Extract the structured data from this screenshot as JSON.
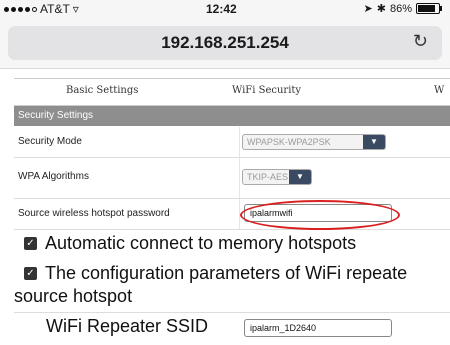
{
  "status_bar": {
    "carrier": "AT&T",
    "time": "12:42",
    "battery": "86%",
    "battery_level": 0.86
  },
  "address_bar": {
    "url": "192.168.251.254"
  },
  "tabs": [
    {
      "label": "Basic Settings"
    },
    {
      "label": "WiFi Security"
    },
    {
      "label": "W"
    }
  ],
  "section": {
    "title": "Security Settings"
  },
  "form": {
    "security_mode": {
      "label": "Security Mode",
      "value": "WPAPSK-WPA2PSK"
    },
    "wpa_algorithms": {
      "label": "WPA Algorithms",
      "value": "TKIP-AES"
    },
    "hotspot_password": {
      "label": "Source wireless hotspot password",
      "value": "ipalarmwifi"
    },
    "auto_connect": {
      "label": "Automatic connect to memory hotspots",
      "checked": true
    },
    "config_params": {
      "line1": "The configuration parameters of WiFi repeate",
      "line2": "source hotspot",
      "checked": true
    },
    "repeater_ssid": {
      "label": "WiFi Repeater SSID",
      "value": "ipalarm_1D2640"
    }
  }
}
